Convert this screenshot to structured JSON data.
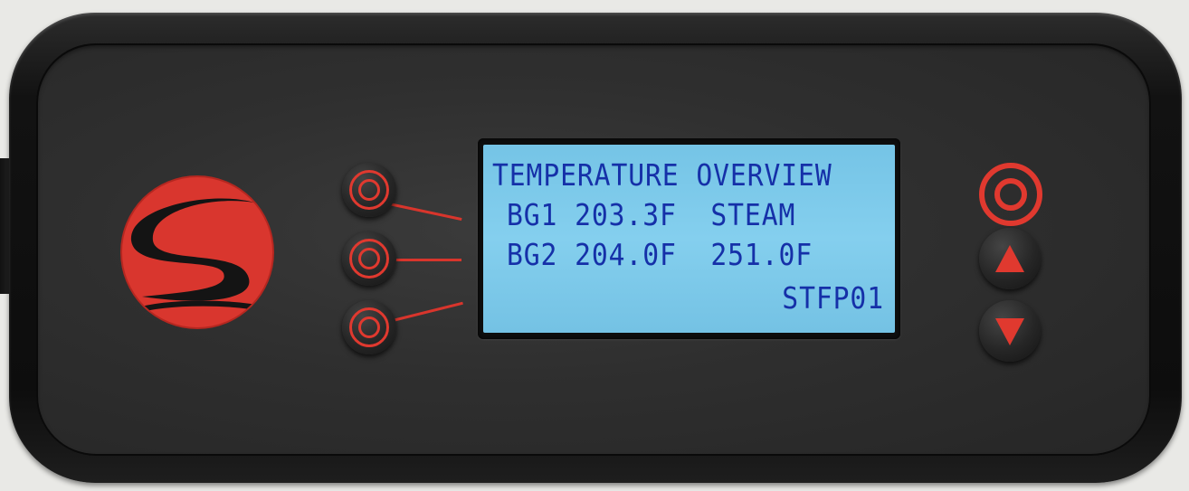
{
  "display": {
    "line1": "TEMPERATURE OVERVIEW",
    "line2": "BG1 203.3F  STEAM",
    "line3": "BG2 204.0F  251.0F",
    "line4": "STFP01"
  },
  "colors": {
    "accent": "#e0392f",
    "lcd_background": "#84cfee",
    "lcd_text": "#1530a8",
    "housing": "#121212"
  },
  "icons": {
    "logo": "stylized-s-logo-icon",
    "soft_keys": "double-ring-icon",
    "power": "double-ring-power-icon",
    "up": "triangle-up-icon",
    "down": "triangle-down-icon"
  }
}
